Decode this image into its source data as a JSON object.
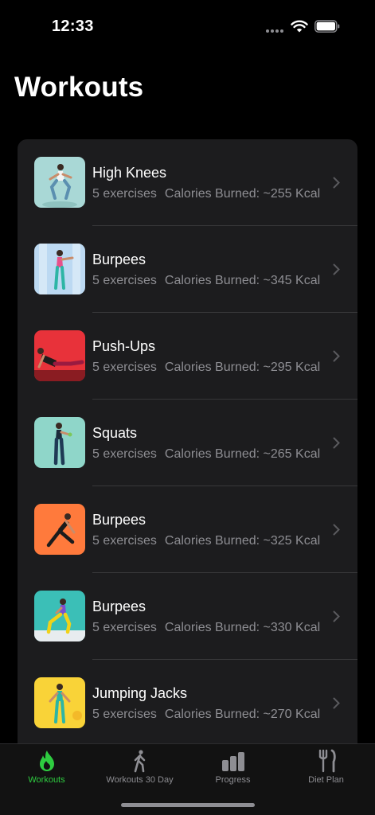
{
  "status_bar": {
    "time": "12:33"
  },
  "header": {
    "title": "Workouts"
  },
  "workouts": [
    {
      "name": "High Knees",
      "exercises": "5 exercises",
      "calories": "Calories Burned: ~255 Kcal",
      "thumb_bg": "#a9d8d6"
    },
    {
      "name": "Burpees",
      "exercises": "5 exercises",
      "calories": "Calories Burned: ~345 Kcal",
      "thumb_bg": "#bcd9f2"
    },
    {
      "name": "Push-Ups",
      "exercises": "5 exercises",
      "calories": "Calories Burned: ~295 Kcal",
      "thumb_bg": "#e8323a"
    },
    {
      "name": "Squats",
      "exercises": "5 exercises",
      "calories": "Calories Burned: ~265 Kcal",
      "thumb_bg": "#8fd6c9"
    },
    {
      "name": "Burpees",
      "exercises": "5 exercises",
      "calories": "Calories Burned: ~325 Kcal",
      "thumb_bg": "#ff7a3c"
    },
    {
      "name": "Burpees",
      "exercises": "5 exercises",
      "calories": "Calories Burned: ~330 Kcal",
      "thumb_bg": "#3bbfb7"
    },
    {
      "name": "Jumping Jacks",
      "exercises": "5 exercises",
      "calories": "Calories Burned: ~270 Kcal",
      "thumb_bg": "#f9d338"
    }
  ],
  "tab_bar": {
    "tabs": [
      {
        "label": "Workouts",
        "icon": "flame-icon",
        "active": true
      },
      {
        "label": "Workouts 30 Day",
        "icon": "walking-person-icon",
        "active": false
      },
      {
        "label": "Progress",
        "icon": "bar-chart-icon",
        "active": false
      },
      {
        "label": "Diet Plan",
        "icon": "fork-knife-icon",
        "active": false
      }
    ]
  },
  "colors": {
    "accent": "#2ecc40",
    "background": "#000000",
    "card": "#1c1c1e",
    "secondary_text": "#8e8e93"
  }
}
